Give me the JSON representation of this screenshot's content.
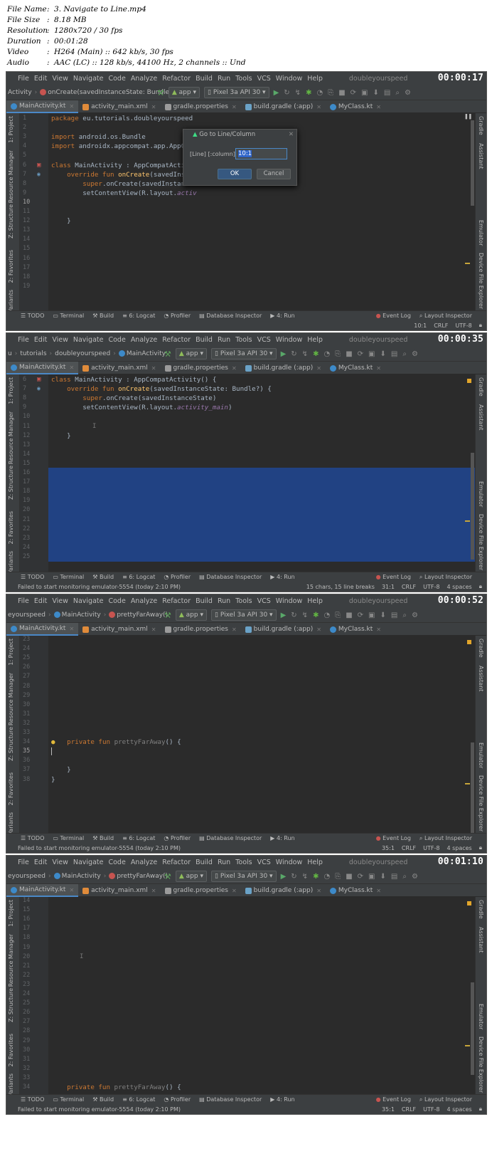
{
  "meta": {
    "rows": [
      {
        "key": "File Name",
        "value": "3. Navigate to Line.mp4"
      },
      {
        "key": "File Size",
        "value": "8.18 MB"
      },
      {
        "key": "Resolution",
        "value": "1280x720 / 30 fps"
      },
      {
        "key": "Duration",
        "value": "00:01:28"
      },
      {
        "key": "Video",
        "value": "H264 (Main) :: 642 kb/s, 30 fps"
      },
      {
        "key": "Audio",
        "value": "AAC (LC) :: 128 kb/s, 44100 Hz, 2 channels :: Und"
      }
    ]
  },
  "menu": [
    "File",
    "Edit",
    "View",
    "Navigate",
    "Code",
    "Analyze",
    "Refactor",
    "Build",
    "Run",
    "Tools",
    "VCS",
    "Window",
    "Help"
  ],
  "project_name": "doubleyourspeed",
  "toolbar": {
    "config": "app",
    "device": "Pixel 3a API 30"
  },
  "tabs": [
    "MainActivity.kt",
    "activity_main.xml",
    "gradle.properties",
    "build.gradle (:app)",
    "MyClass.kt"
  ],
  "left_tools": {
    "project": "1: Project",
    "resource": "Resource Manager",
    "structure": "Z: Structure",
    "favorites": "2: Favorites",
    "variants": "Variants"
  },
  "right_tools": {
    "gradle": "Gradle",
    "assistant": "Assistant",
    "emulator": "Emulator",
    "device": "Device File Explorer"
  },
  "bottom_tools": {
    "todo": "TODO",
    "terminal": "Terminal",
    "build": "Build",
    "logcat": "6: Logcat",
    "profiler": "Profiler",
    "db": "Database Inspector",
    "run": "4: Run",
    "event": "Event Log",
    "layout": "Layout Inspector"
  },
  "status_msg": "Failed to start monitoring emulator-5554 (today 2:10 PM)",
  "encoding": "CRLF",
  "charset": "UTF-8",
  "indent": "4 spaces",
  "frames": [
    {
      "timestamp": "00:00:17",
      "crumbs": [
        "Activity",
        "onCreate(savedInstanceState: Bundle?)"
      ],
      "lines": [
        "1",
        "2",
        "3",
        "4",
        "5",
        "6",
        "7",
        "8",
        "9",
        "10",
        "11",
        "12",
        "13",
        "14",
        "15",
        "16",
        "17",
        "18",
        "19"
      ],
      "code": {
        "pkg": "package",
        "pkg_name": "eu.tutorials.doubleyourspeed",
        "imp": "import",
        "imp1": "android.os.Bundle",
        "imp2": "androidx.appcompat.app.AppCompatActivity",
        "cls": "class",
        "cls_rest": "MainActivity : AppCompatActivity() {",
        "ovr": "override fun",
        "fn": "onCreate",
        "fn_args": "(savedInstanc",
        "sup": "super",
        "sup_rest": ".onCreate(savedInstanceS",
        "scv": "setContentView(R.layout.",
        "scv_it": "activ",
        "brace": "}"
      },
      "dialog": {
        "title": "Go to Line/Column",
        "label": "[Line] [:column]:",
        "value": "10:1",
        "ok": "OK",
        "cancel": "Cancel"
      },
      "pos": "10:1",
      "status_msg": ""
    },
    {
      "timestamp": "00:00:35",
      "crumbs": [
        "u",
        "tutorials",
        "doubleyourspeed",
        "MainActivity"
      ],
      "lines": [
        "6",
        "7",
        "8",
        "9",
        "10",
        "11",
        "12",
        "13",
        "14",
        "15",
        "16",
        "17",
        "18",
        "19",
        "20",
        "21",
        "22",
        "23",
        "24",
        "25"
      ],
      "code": {
        "cls": "class",
        "cls_rest": "MainActivity : AppCompatActivity() {",
        "ovr": "override fun",
        "fn": "onCreate",
        "fn_args": "(savedInstanceState: Bundle?) {",
        "sup": "super",
        "sup_rest": ".onCreate(savedInstanceState)",
        "scv": "setContentView(R.layout.",
        "scv_it": "activity_main",
        "scv_end": ")",
        "brace": "}"
      },
      "sel_info": "15 chars, 15 line breaks",
      "pos": "31:1"
    },
    {
      "timestamp": "00:00:52",
      "crumbs": [
        "eyourspeed",
        "MainActivity",
        "prettyFarAway()"
      ],
      "lines": [
        "23",
        "24",
        "25",
        "26",
        "27",
        "28",
        "29",
        "30",
        "31",
        "32",
        "33",
        "34",
        "35",
        "36",
        "37",
        "38"
      ],
      "code": {
        "priv": "private fun",
        "fn": "prettyFarAway",
        "fn_rest": "() {",
        "brace1": "}",
        "brace2": "}"
      },
      "pos": "35:1"
    },
    {
      "timestamp": "00:01:10",
      "crumbs": [
        "eyourspeed",
        "MainActivity",
        "prettyFarAway()"
      ],
      "lines": [
        "14",
        "15",
        "16",
        "17",
        "18",
        "19",
        "20",
        "21",
        "22",
        "23",
        "24",
        "25",
        "26",
        "27",
        "28",
        "29",
        "30",
        "31",
        "32",
        "33",
        "34"
      ],
      "code": {
        "priv": "private fun",
        "fn": "prettyFarAway",
        "fn_rest": "() {"
      },
      "pos": "35:1"
    }
  ]
}
